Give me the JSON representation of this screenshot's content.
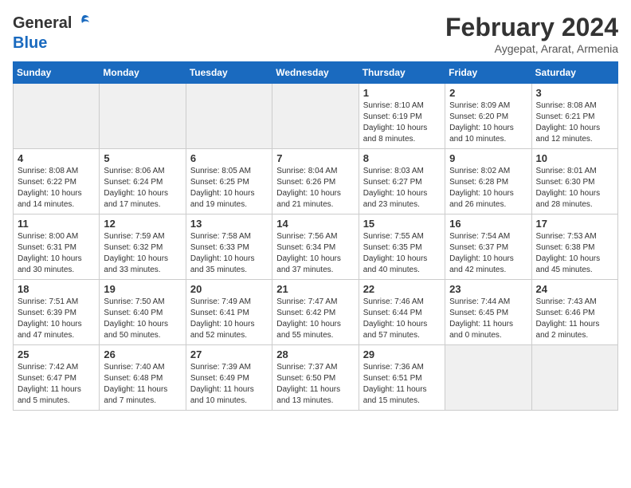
{
  "logo": {
    "general": "General",
    "blue": "Blue"
  },
  "title": "February 2024",
  "subtitle": "Aygepat, Ararat, Armenia",
  "days_of_week": [
    "Sunday",
    "Monday",
    "Tuesday",
    "Wednesday",
    "Thursday",
    "Friday",
    "Saturday"
  ],
  "weeks": [
    [
      {
        "day": "",
        "sunrise": "",
        "sunset": "",
        "daylight": ""
      },
      {
        "day": "",
        "sunrise": "",
        "sunset": "",
        "daylight": ""
      },
      {
        "day": "",
        "sunrise": "",
        "sunset": "",
        "daylight": ""
      },
      {
        "day": "",
        "sunrise": "",
        "sunset": "",
        "daylight": ""
      },
      {
        "day": "1",
        "sunrise": "Sunrise: 8:10 AM",
        "sunset": "Sunset: 6:19 PM",
        "daylight": "Daylight: 10 hours and 8 minutes."
      },
      {
        "day": "2",
        "sunrise": "Sunrise: 8:09 AM",
        "sunset": "Sunset: 6:20 PM",
        "daylight": "Daylight: 10 hours and 10 minutes."
      },
      {
        "day": "3",
        "sunrise": "Sunrise: 8:08 AM",
        "sunset": "Sunset: 6:21 PM",
        "daylight": "Daylight: 10 hours and 12 minutes."
      }
    ],
    [
      {
        "day": "4",
        "sunrise": "Sunrise: 8:08 AM",
        "sunset": "Sunset: 6:22 PM",
        "daylight": "Daylight: 10 hours and 14 minutes."
      },
      {
        "day": "5",
        "sunrise": "Sunrise: 8:06 AM",
        "sunset": "Sunset: 6:24 PM",
        "daylight": "Daylight: 10 hours and 17 minutes."
      },
      {
        "day": "6",
        "sunrise": "Sunrise: 8:05 AM",
        "sunset": "Sunset: 6:25 PM",
        "daylight": "Daylight: 10 hours and 19 minutes."
      },
      {
        "day": "7",
        "sunrise": "Sunrise: 8:04 AM",
        "sunset": "Sunset: 6:26 PM",
        "daylight": "Daylight: 10 hours and 21 minutes."
      },
      {
        "day": "8",
        "sunrise": "Sunrise: 8:03 AM",
        "sunset": "Sunset: 6:27 PM",
        "daylight": "Daylight: 10 hours and 23 minutes."
      },
      {
        "day": "9",
        "sunrise": "Sunrise: 8:02 AM",
        "sunset": "Sunset: 6:28 PM",
        "daylight": "Daylight: 10 hours and 26 minutes."
      },
      {
        "day": "10",
        "sunrise": "Sunrise: 8:01 AM",
        "sunset": "Sunset: 6:30 PM",
        "daylight": "Daylight: 10 hours and 28 minutes."
      }
    ],
    [
      {
        "day": "11",
        "sunrise": "Sunrise: 8:00 AM",
        "sunset": "Sunset: 6:31 PM",
        "daylight": "Daylight: 10 hours and 30 minutes."
      },
      {
        "day": "12",
        "sunrise": "Sunrise: 7:59 AM",
        "sunset": "Sunset: 6:32 PM",
        "daylight": "Daylight: 10 hours and 33 minutes."
      },
      {
        "day": "13",
        "sunrise": "Sunrise: 7:58 AM",
        "sunset": "Sunset: 6:33 PM",
        "daylight": "Daylight: 10 hours and 35 minutes."
      },
      {
        "day": "14",
        "sunrise": "Sunrise: 7:56 AM",
        "sunset": "Sunset: 6:34 PM",
        "daylight": "Daylight: 10 hours and 37 minutes."
      },
      {
        "day": "15",
        "sunrise": "Sunrise: 7:55 AM",
        "sunset": "Sunset: 6:35 PM",
        "daylight": "Daylight: 10 hours and 40 minutes."
      },
      {
        "day": "16",
        "sunrise": "Sunrise: 7:54 AM",
        "sunset": "Sunset: 6:37 PM",
        "daylight": "Daylight: 10 hours and 42 minutes."
      },
      {
        "day": "17",
        "sunrise": "Sunrise: 7:53 AM",
        "sunset": "Sunset: 6:38 PM",
        "daylight": "Daylight: 10 hours and 45 minutes."
      }
    ],
    [
      {
        "day": "18",
        "sunrise": "Sunrise: 7:51 AM",
        "sunset": "Sunset: 6:39 PM",
        "daylight": "Daylight: 10 hours and 47 minutes."
      },
      {
        "day": "19",
        "sunrise": "Sunrise: 7:50 AM",
        "sunset": "Sunset: 6:40 PM",
        "daylight": "Daylight: 10 hours and 50 minutes."
      },
      {
        "day": "20",
        "sunrise": "Sunrise: 7:49 AM",
        "sunset": "Sunset: 6:41 PM",
        "daylight": "Daylight: 10 hours and 52 minutes."
      },
      {
        "day": "21",
        "sunrise": "Sunrise: 7:47 AM",
        "sunset": "Sunset: 6:42 PM",
        "daylight": "Daylight: 10 hours and 55 minutes."
      },
      {
        "day": "22",
        "sunrise": "Sunrise: 7:46 AM",
        "sunset": "Sunset: 6:44 PM",
        "daylight": "Daylight: 10 hours and 57 minutes."
      },
      {
        "day": "23",
        "sunrise": "Sunrise: 7:44 AM",
        "sunset": "Sunset: 6:45 PM",
        "daylight": "Daylight: 11 hours and 0 minutes."
      },
      {
        "day": "24",
        "sunrise": "Sunrise: 7:43 AM",
        "sunset": "Sunset: 6:46 PM",
        "daylight": "Daylight: 11 hours and 2 minutes."
      }
    ],
    [
      {
        "day": "25",
        "sunrise": "Sunrise: 7:42 AM",
        "sunset": "Sunset: 6:47 PM",
        "daylight": "Daylight: 11 hours and 5 minutes."
      },
      {
        "day": "26",
        "sunrise": "Sunrise: 7:40 AM",
        "sunset": "Sunset: 6:48 PM",
        "daylight": "Daylight: 11 hours and 7 minutes."
      },
      {
        "day": "27",
        "sunrise": "Sunrise: 7:39 AM",
        "sunset": "Sunset: 6:49 PM",
        "daylight": "Daylight: 11 hours and 10 minutes."
      },
      {
        "day": "28",
        "sunrise": "Sunrise: 7:37 AM",
        "sunset": "Sunset: 6:50 PM",
        "daylight": "Daylight: 11 hours and 13 minutes."
      },
      {
        "day": "29",
        "sunrise": "Sunrise: 7:36 AM",
        "sunset": "Sunset: 6:51 PM",
        "daylight": "Daylight: 11 hours and 15 minutes."
      },
      {
        "day": "",
        "sunrise": "",
        "sunset": "",
        "daylight": ""
      },
      {
        "day": "",
        "sunrise": "",
        "sunset": "",
        "daylight": ""
      }
    ]
  ]
}
